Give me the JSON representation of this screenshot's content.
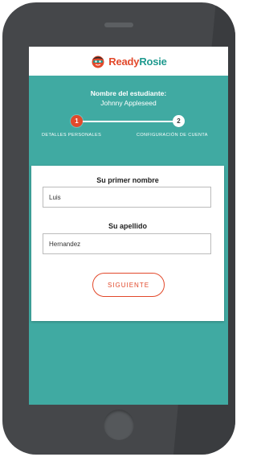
{
  "app": {
    "brand_part1": "Ready",
    "brand_part2": "Rosie"
  },
  "student": {
    "label": "Nombre del estudiante:",
    "name": "Johnny Appleseed"
  },
  "steps": [
    {
      "number": "1",
      "label": "DETALLES PERSONALES",
      "state": "active"
    },
    {
      "number": "2",
      "label": "CONFIGURACIÓN DE CUENTA",
      "state": "upcoming"
    }
  ],
  "form": {
    "first_name_label": "Su primer nombre",
    "first_name_value": "Luis",
    "last_name_label": "Su apellido",
    "last_name_value": "Hernandez",
    "submit_label": "SIGUIENTE"
  },
  "colors": {
    "teal": "#40aaa2",
    "accent_red": "#e2492b",
    "phone_body": "#45474a"
  },
  "icons": {
    "logo": "readyrosie-mascot-icon"
  }
}
